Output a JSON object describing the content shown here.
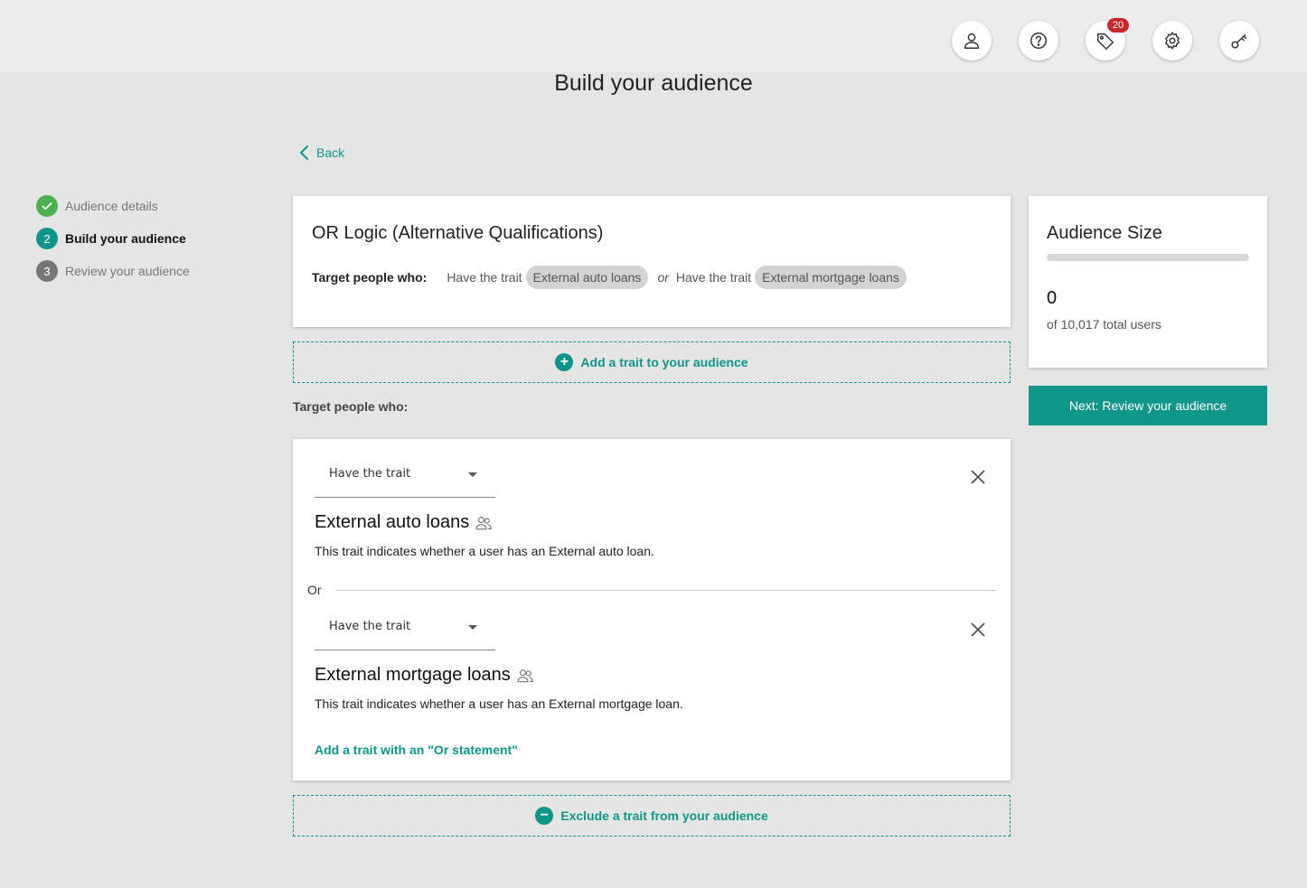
{
  "header": {
    "title": "Build your audience",
    "icons": [
      {
        "name": "user-icon",
        "badge": ""
      },
      {
        "name": "help-icon",
        "badge": ""
      },
      {
        "name": "tag-icon",
        "badge": "20"
      },
      {
        "name": "gear-icon",
        "badge": ""
      },
      {
        "name": "key-icon",
        "badge": ""
      }
    ]
  },
  "colors": {
    "accent": "#10958a",
    "done": "#4caf50",
    "badge": "#c8262b"
  },
  "steps": [
    {
      "number": "✓",
      "label": "Audience details",
      "state": "done"
    },
    {
      "number": "2",
      "label": "Build your audience",
      "state": "active"
    },
    {
      "number": "3",
      "label": "Review your audience",
      "state": "todo"
    }
  ],
  "back_label": "Back",
  "logic": {
    "title": "OR Logic (Alternative Qualifications)",
    "target_label": "Target people who:",
    "clause1_prefix": "Have the trait",
    "clause1_trait": "External auto loans",
    "or_word": "or",
    "clause2_prefix": "Have the trait",
    "clause2_trait": "External mortgage loans"
  },
  "add_trait_label": "Add a trait to your audience",
  "target_label": "Target people who:",
  "traits": [
    {
      "condition": "Have the trait",
      "name": "External auto loans",
      "description": "This trait indicates whether a user has an External auto loan."
    },
    {
      "condition": "Have the trait",
      "name": "External mortgage loans",
      "description": "This trait indicates whether a user has an External mortgage loan."
    }
  ],
  "or_divider": "Or",
  "add_or_label": "Add a trait with an \"Or statement\"",
  "exclude_label": "Exclude a trait from your audience",
  "audience_size": {
    "title": "Audience Size",
    "progress": 0,
    "count": "0",
    "total": "of 10,017 total users"
  },
  "next_label": "Next: Review your audience"
}
